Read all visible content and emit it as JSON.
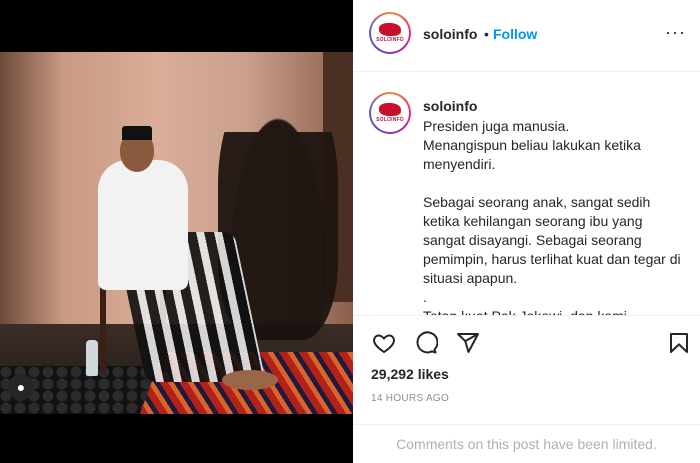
{
  "post": {
    "username": "soloinfo",
    "separator": "•",
    "follow_label": "Follow",
    "more_label": "···",
    "avatar_logo_text": "SOLOINFO",
    "caption_username": "soloinfo",
    "caption_text": "Presiden juga manusia.\nMenangispun beliau lakukan ketika menyendiri.\n\nSebagai seorang anak, sangat sedih ketika kehilangan seorang ibu yang sangat disayangi. Sebagai seorang pemimpin, harus terlihat kuat dan tegar di situasi apapun.\n.\nTetap kuat Pak Jokowi, dan kami",
    "likes_label": "29,292 likes",
    "time_label": "14 HOURS AGO",
    "comments_limited_label": "Comments on this post have been limited.",
    "tag_icon_glyph": "●"
  },
  "icons": {
    "like": "heart-icon",
    "comment": "comment-icon",
    "share": "paper-plane-icon",
    "save": "bookmark-icon",
    "tag": "user-tag-icon"
  },
  "colors": {
    "follow": "#0095f6",
    "text": "#262626",
    "muted": "#8e8e8e",
    "brand_logo": "#c8102e"
  }
}
